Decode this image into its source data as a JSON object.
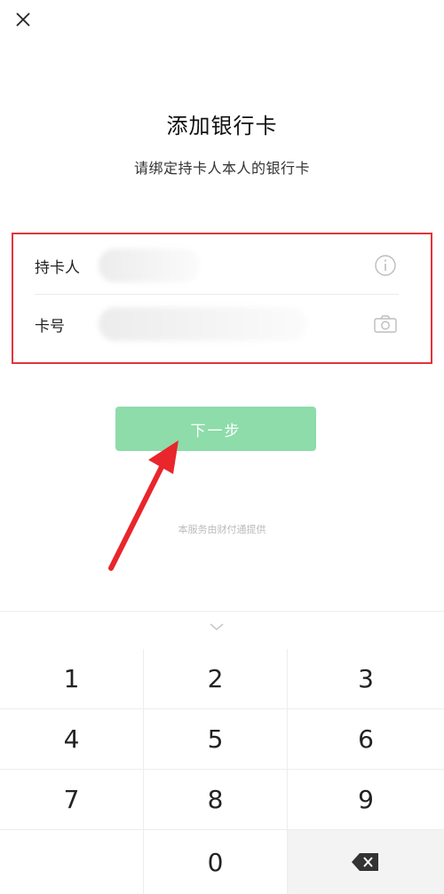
{
  "header": {
    "close_icon": "close-icon"
  },
  "page": {
    "title": "添加银行卡",
    "subtitle": "请绑定持卡人本人的银行卡"
  },
  "form": {
    "cardholder_label": "持卡人",
    "cardholder_value": "",
    "cardholder_info_icon": "info-icon",
    "card_number_label": "卡号",
    "card_number_value": "",
    "card_number_camera_icon": "camera-icon",
    "highlight_color": "#e0353b"
  },
  "actions": {
    "next_label": "下一步",
    "next_color": "#8ddcaa"
  },
  "footer": {
    "note": "本服务由财付通提供"
  },
  "keyboard": {
    "handle_icon": "chevron-down-icon",
    "keys": [
      "1",
      "2",
      "3",
      "4",
      "5",
      "6",
      "7",
      "8",
      "9",
      "",
      "0"
    ],
    "delete_icon": "backspace-icon"
  },
  "annotation": {
    "arrow_color": "#e8262b"
  }
}
